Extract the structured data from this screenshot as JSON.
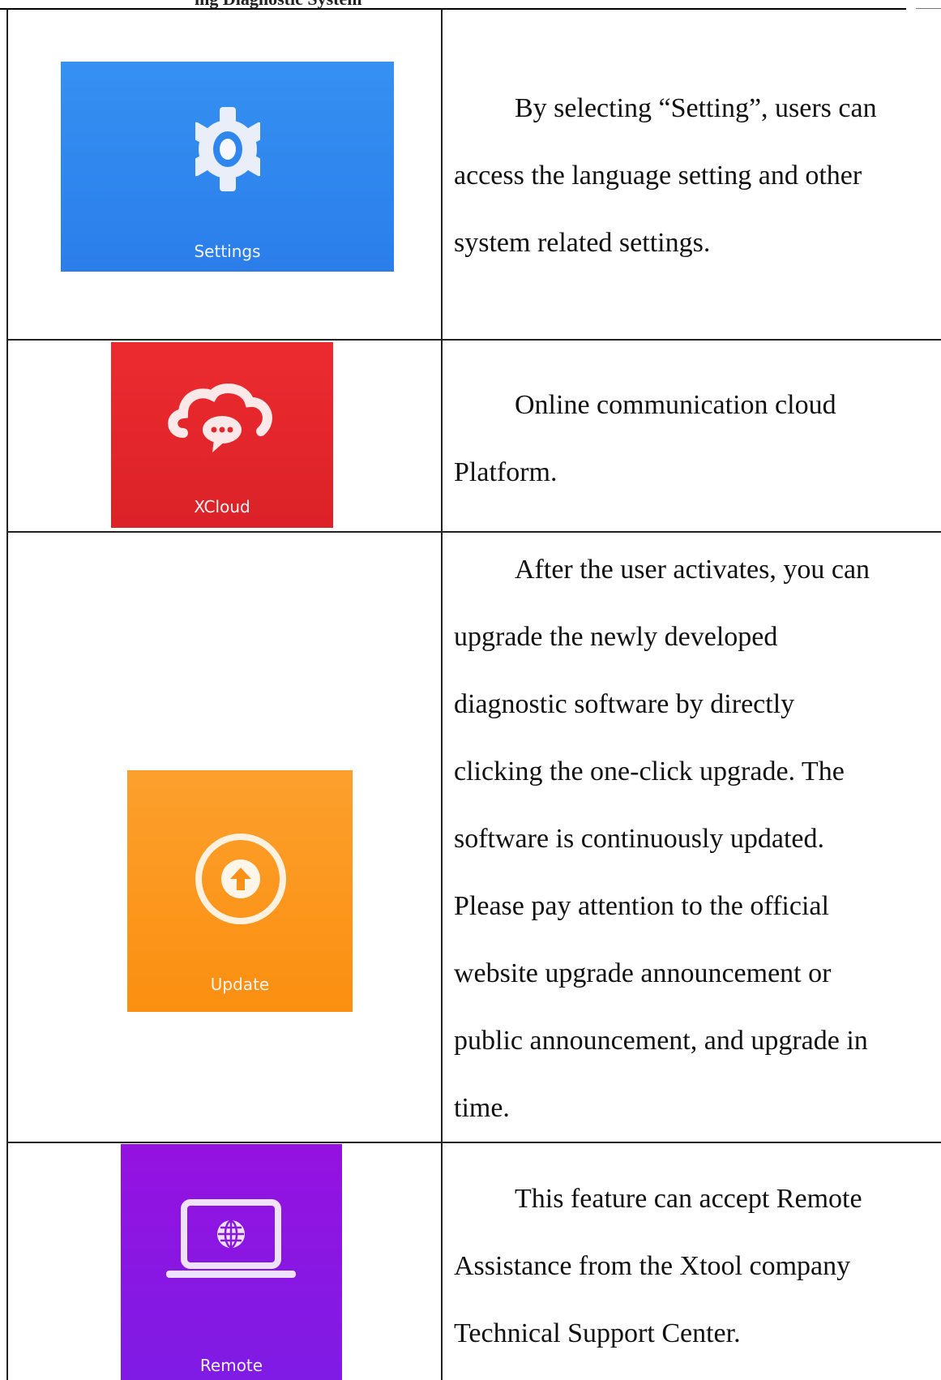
{
  "header": {
    "fragment": "ing Diagnostic System"
  },
  "rows": [
    {
      "tile_label": "Settings",
      "icon": "gear-icon",
      "tile_color": "#2f86ef",
      "lines": [
        "By selecting “Setting”, users can",
        "access the language setting and other",
        "system related settings."
      ]
    },
    {
      "tile_label": "XCloud",
      "icon": "cloud-chat-icon",
      "tile_color": "#e5272b",
      "lines": [
        "Online communication cloud",
        "Platform."
      ]
    },
    {
      "tile_label": "Update",
      "icon": "upload-arrow-icon",
      "tile_color": "#fb9116",
      "lines": [
        "After the user activates, you can",
        "upgrade the newly developed",
        "diagnostic software by directly",
        "clicking the one-click upgrade. The",
        "software is continuously updated.",
        "Please pay attention to the official",
        "website upgrade announcement or",
        "public announcement, and upgrade in",
        "time."
      ]
    },
    {
      "tile_label": "Remote",
      "icon": "laptop-globe-icon",
      "tile_color": "#8a16e2",
      "lines": [
        "This feature can accept Remote",
        "Assistance from the Xtool company",
        "Technical Support Center."
      ]
    }
  ]
}
